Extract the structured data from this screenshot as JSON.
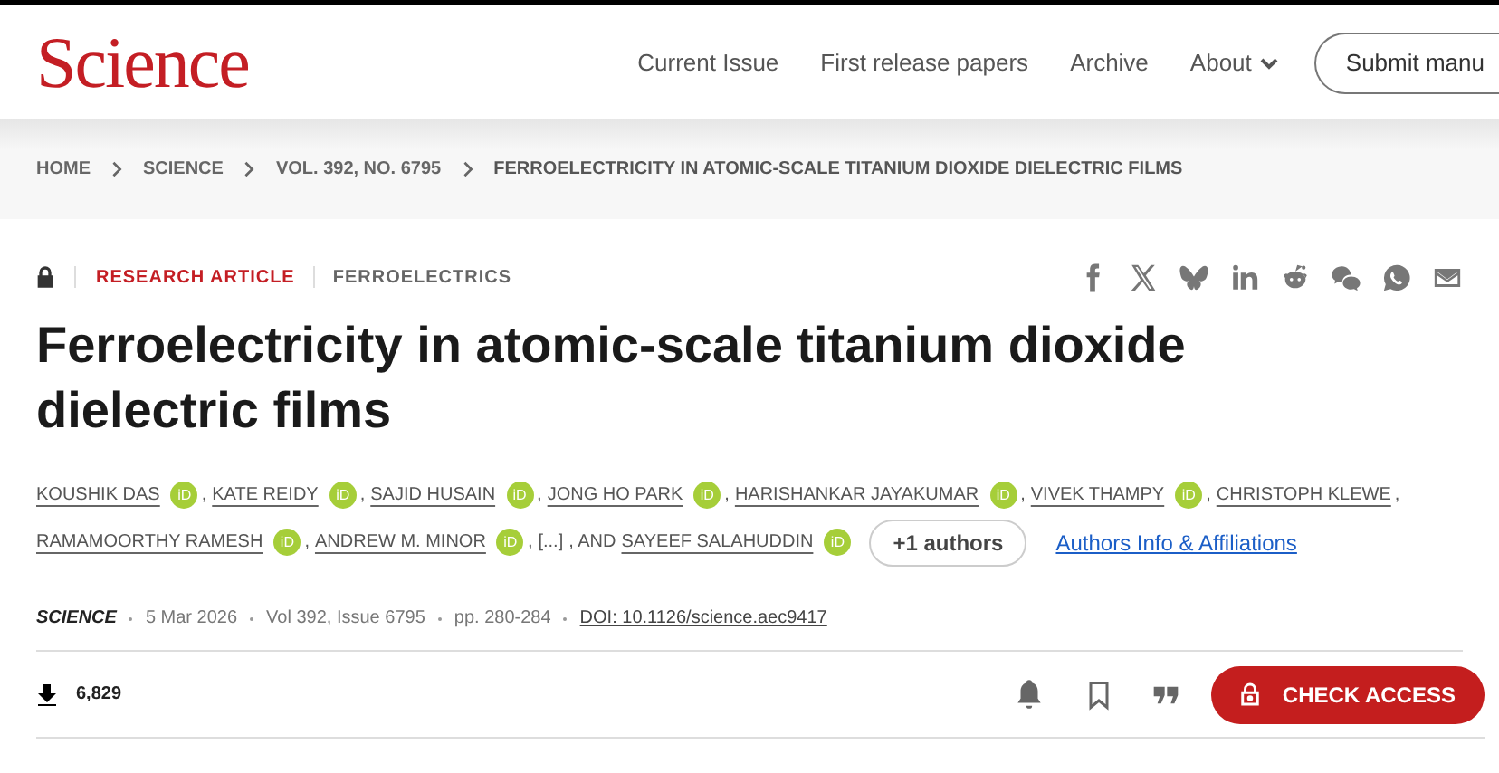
{
  "header": {
    "logo": "Science",
    "nav": [
      {
        "label": "Current Issue",
        "kind": "link"
      },
      {
        "label": "First release papers",
        "kind": "link"
      },
      {
        "label": "Archive",
        "kind": "link"
      },
      {
        "label": "About",
        "kind": "dropdown"
      }
    ],
    "submit_button": "Submit manu"
  },
  "breadcrumb": [
    "HOME",
    "SCIENCE",
    "VOL. 392, NO. 6795",
    "FERROELECTRICITY IN ATOMIC-SCALE TITANIUM DIOXIDE DIELECTRIC FILMS"
  ],
  "article_meta": {
    "locked": true,
    "type": "RESEARCH ARTICLE",
    "subject": "FERROELECTRICS"
  },
  "title": "Ferroelectricity in atomic-scale titanium dioxide dielectric films",
  "author_lines": [
    [
      {
        "kind": "author",
        "name": "KOUSHIK DAS",
        "orcid": "iD"
      },
      {
        "kind": "text",
        "text": ","
      },
      {
        "kind": "author",
        "name": "KATE REIDY",
        "orcid": "iD"
      },
      {
        "kind": "text",
        "text": ","
      },
      {
        "kind": "author",
        "name": "SAJID HUSAIN",
        "orcid": "iD"
      },
      {
        "kind": "text",
        "text": ","
      },
      {
        "kind": "author",
        "name": "JONG HO PARK",
        "orcid": "iD"
      },
      {
        "kind": "text",
        "text": ","
      },
      {
        "kind": "author",
        "name": "HARISHANKAR JAYAKUMAR",
        "orcid": "iD"
      },
      {
        "kind": "text",
        "text": ","
      },
      {
        "kind": "author",
        "name": "VIVEK THAMPY",
        "orcid": "iD"
      },
      {
        "kind": "text",
        "text": ","
      },
      {
        "kind": "author",
        "name": "CHRISTOPH KLEWE"
      },
      {
        "kind": "text",
        "text": ","
      }
    ],
    [
      {
        "kind": "author",
        "name": "RAMAMOORTHY RAMESH",
        "orcid": "iD"
      },
      {
        "kind": "text",
        "text": ","
      },
      {
        "kind": "author",
        "name": "ANDREW M. MINOR",
        "orcid": "iD"
      },
      {
        "kind": "text",
        "text": ","
      },
      {
        "kind": "more",
        "text": "[...]"
      },
      {
        "kind": "text",
        "text": ", AND"
      },
      {
        "kind": "author",
        "name": "SAYEEF SALAHUDDIN",
        "orcid": "iD"
      },
      {
        "kind": "pill",
        "text": "+1 authors"
      },
      {
        "kind": "link",
        "text": "Authors Info & Affiliations"
      }
    ]
  ],
  "citation": {
    "journal": "SCIENCE",
    "items": [
      "5 Mar 2026",
      "Vol 392, Issue 6795",
      "pp. 280-284"
    ],
    "doi": "DOI: 10.1126/science.aec9417"
  },
  "downloads": "6,829",
  "access_button": "CHECK ACCESS"
}
